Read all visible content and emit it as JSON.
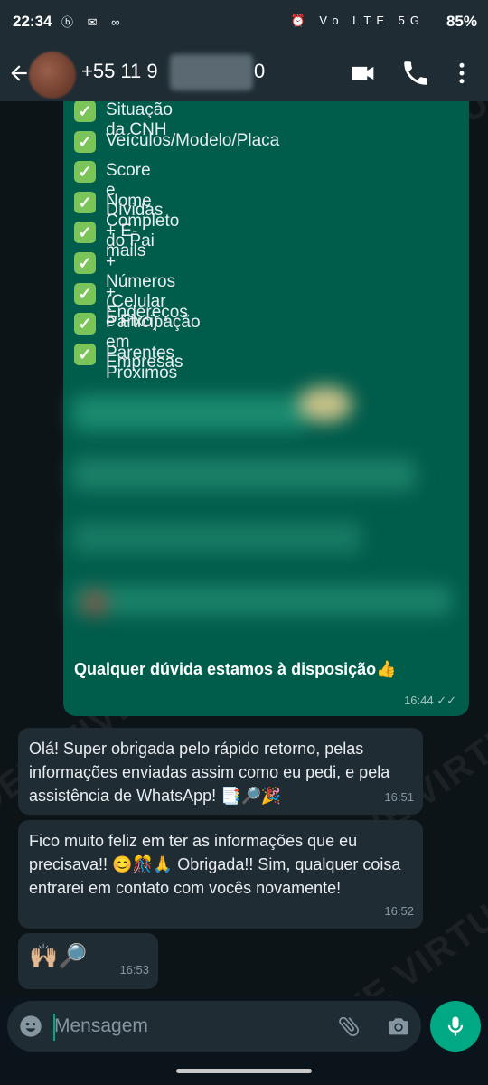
{
  "status_bar": {
    "time": "22:34",
    "left_icons": "ⓑ ✉ ∞",
    "right_icons": "⏰ Vo LTE 5G",
    "battery": "85%"
  },
  "header": {
    "contact": "+55 11 9",
    "contact_end": "0",
    "icons": [
      "back-arrow-icon",
      "video-call-icon",
      "voice-call-icon",
      "more-options-icon"
    ]
  },
  "watermark": "DETETIVE VIRTUAL",
  "outgoing": {
    "checklist": [
      "Situação da CNH",
      "Veículos/Modelo/Placa",
      "Score e Dívidas",
      "Nome Completo do Pai",
      "+ E-mails",
      "+ Números (Celular e Fixo)",
      "+ Endereços",
      "Participação em Empresas",
      "Parentes Próximos"
    ],
    "check_glyph": "✓",
    "footer": "Qualquer dúvida estamos à disposição👍",
    "time": "16:44 ✓✓"
  },
  "incoming": [
    {
      "text": "Olá! Super obrigada pelo rápido retorno, pelas informações enviadas assim como eu pedi, e pela assistência de WhatsApp! 📑🔎🎉",
      "time": "16:51"
    },
    {
      "text": "Fico muito feliz em ter as informações que eu precisava!! 😊🎊🙏 Obrigada!! Sim, qualquer coisa entrarei em contato com vocês novamente!",
      "time": "16:52"
    },
    {
      "text": "🙌🏼🔎",
      "time": "16:53"
    }
  ],
  "input": {
    "placeholder": "Mensagem"
  },
  "colors": {
    "outgoing_bubble": "#005c4b",
    "incoming_bubble": "#202c33",
    "accent": "#00a884",
    "header": "#1f2c34"
  }
}
